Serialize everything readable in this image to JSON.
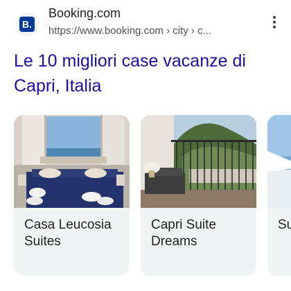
{
  "result": {
    "site_name": "Booking.com",
    "site_url": "https://www.booking.com › city › c...",
    "favicon_letter": "B.",
    "title": "Le 10 migliori case vacanze di Capri, Italia"
  },
  "cards": [
    {
      "title": "Casa Leucosia Suites"
    },
    {
      "title": "Capri Suite Dreams"
    },
    {
      "title": "Su Ca Se"
    }
  ],
  "colors": {
    "title_link": "#1a0dab",
    "brand": "#003b95",
    "card_bg": "#f1f3f4"
  }
}
